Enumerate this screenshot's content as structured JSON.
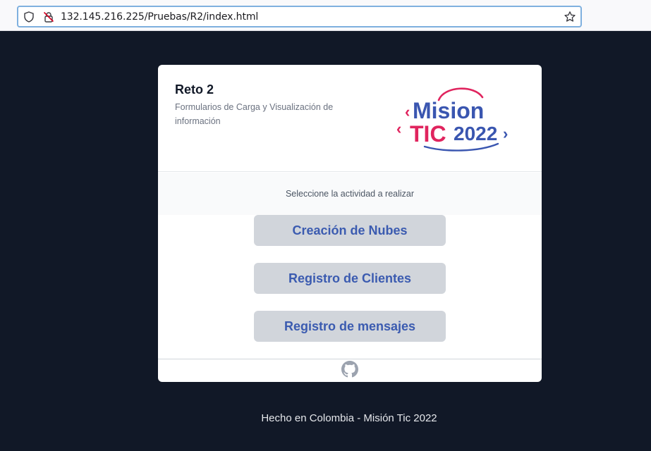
{
  "browser": {
    "url": "132.145.216.225/Pruebas/R2/index.html",
    "icons": [
      "shield-icon",
      "insecure-lock-icon",
      "bookmark-star-icon"
    ]
  },
  "card": {
    "title": "Reto 2",
    "subtitle": "Formularios de Carga y Visualización de información",
    "logo": {
      "line1": "Mision",
      "line2_word": "TIC",
      "line2_year": "2022",
      "left_chevron": "‹",
      "right_chevron": "›"
    },
    "prompt": "Seleccione la actividad a realizar",
    "buttons": [
      {
        "label": "Creación de Nubes"
      },
      {
        "label": "Registro de Clientes"
      },
      {
        "label": "Registro de mensajes"
      }
    ],
    "footer_icon": "github-icon"
  },
  "page_footer": "Hecho en Colombia - Misión Tic 2022",
  "colors": {
    "background": "#111827",
    "button_bg": "#d1d5db",
    "button_text": "#3b5bb0",
    "logo_blue": "#3a56b0",
    "logo_pink": "#e0245e"
  }
}
